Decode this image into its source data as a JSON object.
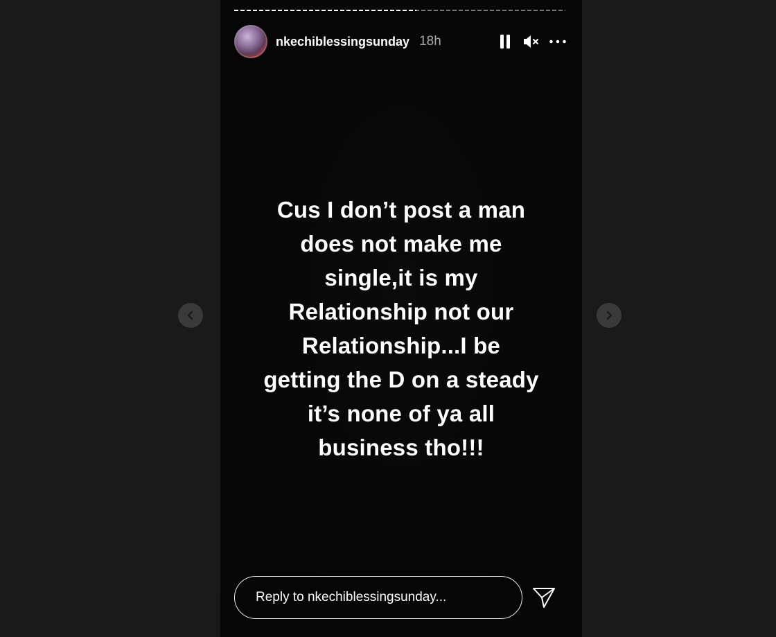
{
  "story": {
    "progress_fraction": 0.55,
    "username": "nkechiblessingsunday",
    "time_ago": "18h",
    "caption": "Cus I don’t post a man\ndoes not make me\nsingle,it is my\nRelationship not our\nRelationship...I be\ngetting the D on a steady\nit’s none of ya all\nbusiness tho!!!",
    "controls": {
      "pause_icon": "pause-icon",
      "mute_icon": "muted-speaker-icon",
      "more_icon": "more-horizontal-icon"
    }
  },
  "reply": {
    "placeholder": "Reply to nkechiblessingsunday...",
    "send_icon": "send-icon"
  },
  "navigation": {
    "prev_icon": "chevron-left-icon",
    "next_icon": "chevron-right-icon"
  },
  "colors": {
    "page_background": "#1a1a1a",
    "story_background": "#070707",
    "text": "#ffffff",
    "nav_button": "#3a3a3a"
  }
}
